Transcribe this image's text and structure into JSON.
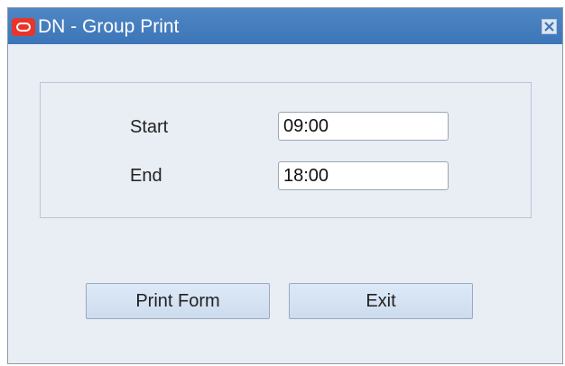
{
  "window": {
    "title": "DN - Group Print",
    "close_icon": "close-x-icon",
    "logo_icon": "oracle-logo-icon"
  },
  "form": {
    "start": {
      "label": "Start",
      "value": "09:00"
    },
    "end": {
      "label": "End",
      "value": "18:00"
    }
  },
  "buttons": {
    "print_form": "Print Form",
    "exit": "Exit"
  },
  "colors": {
    "titlebar": "#3c76b8",
    "window_bg": "#e9edf4",
    "logo_red": "#e8352b",
    "button_bg": "#d6e3f3"
  }
}
